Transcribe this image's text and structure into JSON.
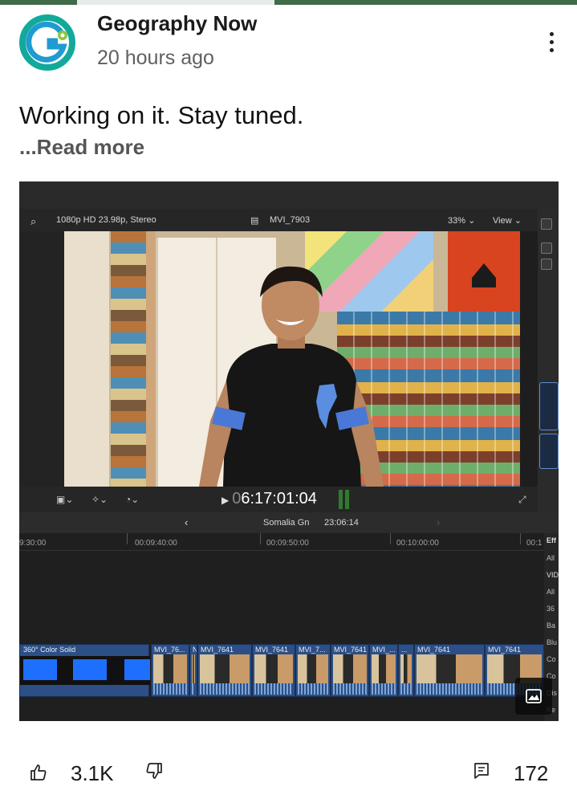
{
  "post": {
    "channel_name": "Geography Now",
    "time_ago": "20 hours ago",
    "text": "Working on it. Stay tuned.",
    "read_more": "...Read more",
    "like_count": "3.1K",
    "comment_count": "172"
  },
  "editor": {
    "format_label": "1080p HD 23.98p, Stereo",
    "clip_name": "MVI_7903",
    "zoom": "33% ⌄",
    "view": "View ⌄",
    "timecode_prefix": "0",
    "timecode": "6:17:01:04",
    "project_name": "Somalia Gn",
    "project_duration": "23:06:14",
    "ruler_labels": [
      "9:30:00",
      "00:09:40:00",
      "00:09:50:00",
      "00:10:00:00",
      "00:1"
    ],
    "effects_labels": [
      "Eff",
      "All",
      "VID",
      "All",
      "36",
      "Ba",
      "Blu",
      "Co",
      "Co",
      "Dis",
      "Ke"
    ],
    "solid_clip_label": "360° Color Solid",
    "clips": [
      {
        "label": "MVI_76..."
      },
      {
        "label": "N"
      },
      {
        "label": "MVI_7641"
      },
      {
        "label": "MVI_7641"
      },
      {
        "label": "MVI_7..."
      },
      {
        "label": "MVI_7641"
      },
      {
        "label": "MVI_..."
      },
      {
        "label": "..."
      },
      {
        "label": "MVI_7641"
      },
      {
        "label": "MVI_7641"
      }
    ]
  },
  "theme": {
    "accent_green": "#3f6b46",
    "clip_blue": "#2b4f86",
    "solid_blue": "#1f6fff"
  },
  "icons": {
    "avatar": "geography-now-logo",
    "more": "vertical-dots-icon",
    "like": "thumbs-up-icon",
    "dislike": "thumbs-down-icon",
    "comment": "comment-icon",
    "image": "image-icon"
  }
}
